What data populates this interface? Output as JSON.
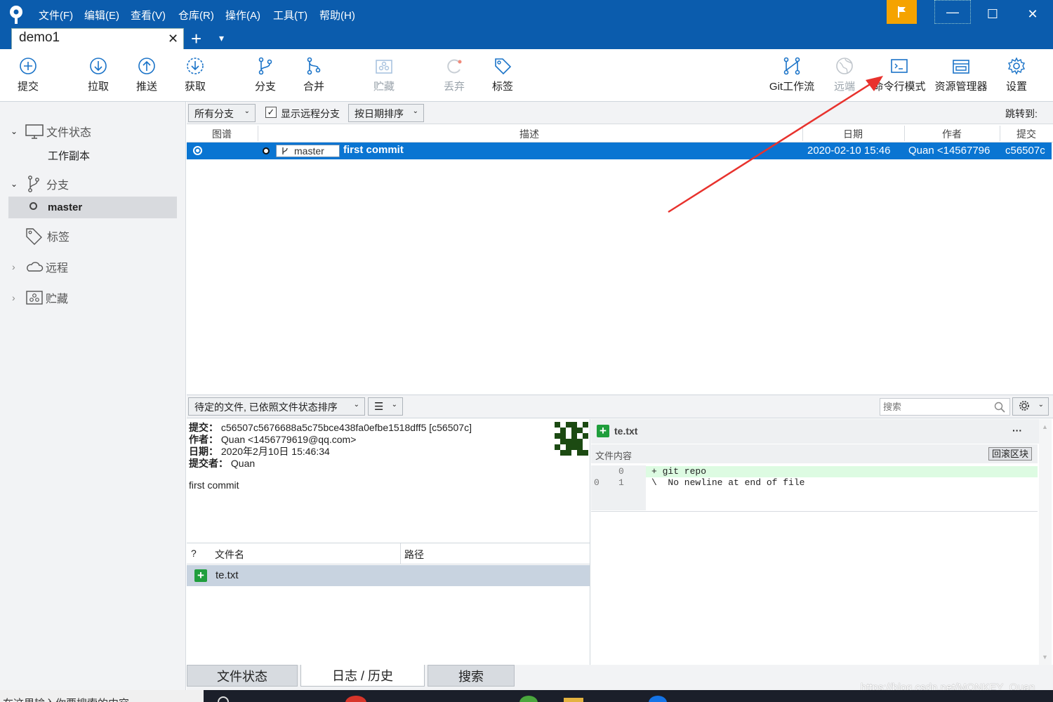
{
  "menu": [
    "文件(F)",
    "编辑(E)",
    "查看(V)",
    "仓库(R)",
    "操作(A)",
    "工具(T)",
    "帮助(H)"
  ],
  "window": {
    "minimize": "—",
    "maximize": "☐",
    "close": "✕"
  },
  "tab": {
    "title": "demo1",
    "close": "✕",
    "add": "+",
    "dropdown": "▾"
  },
  "toolbar_left": [
    {
      "label": "提交",
      "icon": "plus-circle-icon"
    },
    {
      "label": "拉取",
      "icon": "arrow-down-circle-icon"
    },
    {
      "label": "推送",
      "icon": "arrow-up-circle-icon"
    },
    {
      "label": "获取",
      "icon": "fetch-icon"
    },
    {
      "label": "分支",
      "icon": "branch-icon"
    },
    {
      "label": "合并",
      "icon": "merge-icon"
    },
    {
      "label": "贮藏",
      "icon": "stash-icon"
    },
    {
      "label": "丢弃",
      "icon": "discard-icon"
    },
    {
      "label": "标签",
      "icon": "tag-icon"
    }
  ],
  "toolbar_right": [
    {
      "label": "Git工作流",
      "icon": "gitflow-icon"
    },
    {
      "label": "远端",
      "icon": "globe-icon"
    },
    {
      "label": "命令行模式",
      "icon": "terminal-icon"
    },
    {
      "label": "资源管理器",
      "icon": "explorer-icon"
    },
    {
      "label": "设置",
      "icon": "gear-icon"
    }
  ],
  "sidebar": {
    "file_status": "文件状态",
    "working_copy": "工作副本",
    "branches": "分支",
    "branch_master": "master",
    "tags": "标签",
    "remotes": "远程",
    "stashes": "贮藏"
  },
  "filter": {
    "branches": "所有分支",
    "show_remote": "显示远程分支",
    "sort": "按日期排序",
    "jump_to": "跳转到:"
  },
  "log_headers": {
    "graph": "图谱",
    "description": "描述",
    "date": "日期",
    "author": "作者",
    "commit": "提交"
  },
  "commit_row": {
    "branch": "master",
    "message": "first commit",
    "date": "2020-02-10 15:46",
    "author": "Quan <14567796",
    "hash": "c56507c"
  },
  "lower": {
    "pending": "待定的文件, 已依照文件状态排序",
    "search_placeholder": "搜索"
  },
  "commit_info": {
    "commit_label": "提交：",
    "commit_value": "c56507c5676688a5c75bce438fa0efbe1518dff5 [c56507c]",
    "author_label": "作者：",
    "author_value": "Quan <1456779619@qq.com>",
    "date_label": "日期：",
    "date_value": "2020年2月10日 15:46:34",
    "committer_label": "提交者：",
    "committer_value": "Quan",
    "message": "first commit"
  },
  "file_list": {
    "col_status": "?",
    "col_name": "文件名",
    "col_path": "路径",
    "file": "te.txt"
  },
  "diff": {
    "file": "te.txt",
    "more": "···",
    "section": "文件内容",
    "rollback": "回滚区块",
    "lines": [
      {
        "old": "",
        "new": "0",
        "text": "+ git repo",
        "added": true
      },
      {
        "old": "0",
        "new": "1",
        "text": "\\  No newline at end of file",
        "added": false
      }
    ]
  },
  "bottom_tabs": [
    "文件状态",
    "日志 / 历史",
    "搜索"
  ],
  "watermark": "https://blog.csdn.net/MONKEY_Quan",
  "taskbar_text": "在这里输入你要搜索的内容",
  "colors": {
    "titlebar": "#0b5cad",
    "selected_row": "#0a75d2",
    "flag": "#f5a300",
    "annotation_arrow": "#e8322d"
  }
}
